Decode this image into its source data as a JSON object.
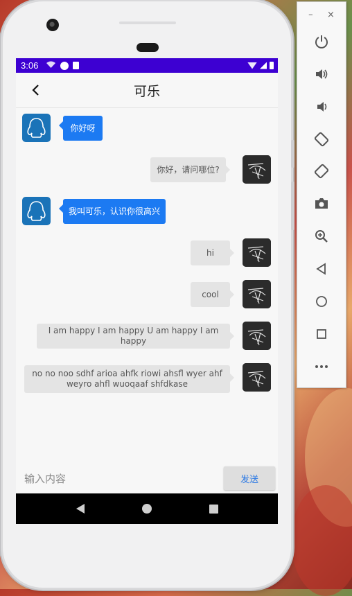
{
  "status_bar": {
    "time": "3:06"
  },
  "chat": {
    "title": "可乐",
    "messages": [
      {
        "side": "left",
        "text": "你好呀"
      },
      {
        "side": "right",
        "text": "你好，请问哪位?"
      },
      {
        "side": "left",
        "text": "我叫可乐，认识你很高兴"
      },
      {
        "side": "right",
        "text": "hi"
      },
      {
        "side": "right",
        "text": "cool"
      },
      {
        "side": "right",
        "text": "I am happy I am happy U am happy I am happy"
      },
      {
        "side": "right",
        "text": "no no noo sdhf arioa ahfk riowi ahsfl wyer ahf weyro ahfl wuoqaaf shfdkase"
      }
    ]
  },
  "input": {
    "placeholder": "输入内容",
    "send_label": "发送"
  },
  "emulator": {
    "minimize_label": "–",
    "close_label": "×",
    "tools": [
      "power-icon",
      "volume-up-icon",
      "volume-down-icon",
      "rotate-left-icon",
      "rotate-right-icon",
      "camera-icon",
      "zoom-icon",
      "back-icon",
      "home-icon",
      "overview-icon",
      "more-icon"
    ]
  },
  "colors": {
    "status_bar": "#3d00d2",
    "incoming_bubble": "#1c7af2",
    "outgoing_bubble": "#e4e4e4",
    "send_text": "#2a78e4"
  }
}
